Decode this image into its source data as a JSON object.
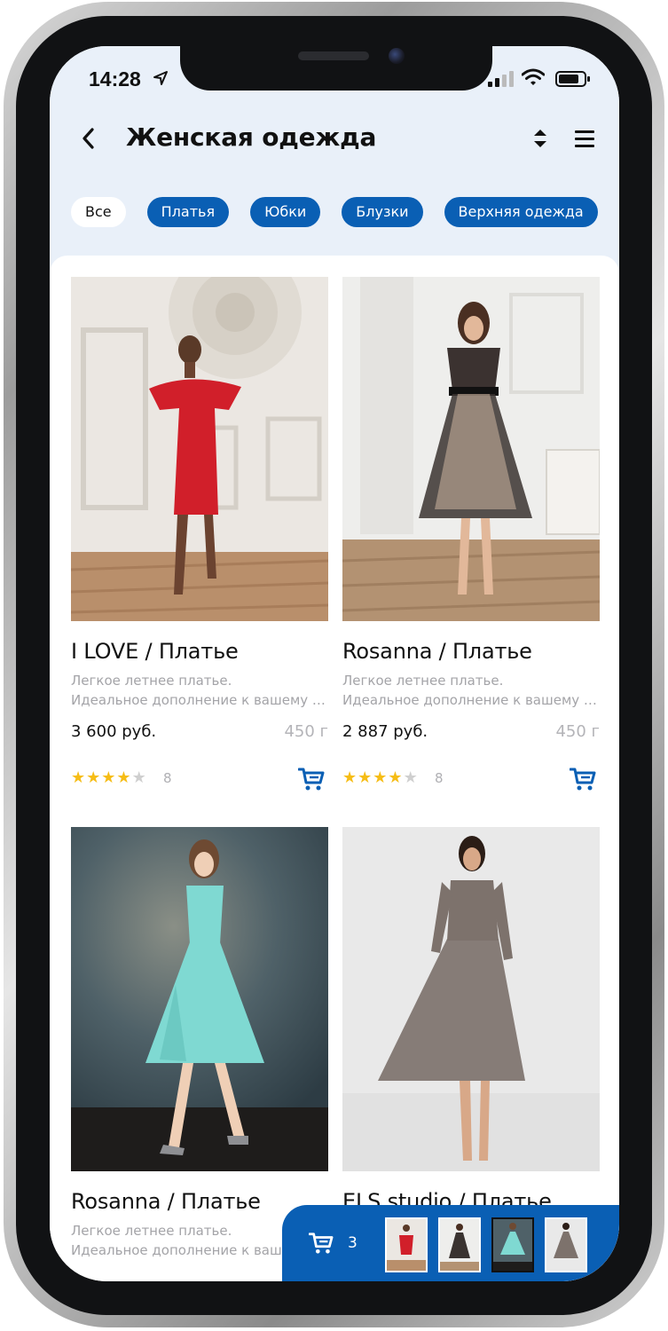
{
  "status_bar": {
    "time": "14:28"
  },
  "header": {
    "title": "Женская одежда",
    "back_icon": "chevron-left-icon",
    "sort_icon": "sort-icon",
    "menu_icon": "hamburger-menu-icon"
  },
  "categories": [
    {
      "label": "Все",
      "active": true
    },
    {
      "label": "Платья",
      "active": false
    },
    {
      "label": "Юбки",
      "active": false
    },
    {
      "label": "Блузки",
      "active": false
    },
    {
      "label": "Верхняя одежда",
      "active": false
    }
  ],
  "products": [
    {
      "name": "I LOVE / Платье",
      "desc_line1": "Легкое летнее платье.",
      "desc_line2": "Идеальное дополнение к вашему гардеробу",
      "price": "3 600 руб.",
      "weight": "450 г",
      "rating": 4,
      "rating_max": 5,
      "reviews": "8",
      "dress_color": "#d11f2a"
    },
    {
      "name": "Rosanna / Платье",
      "desc_line1": "Легкое летнее платье.",
      "desc_line2": "Идеальное дополнение к вашему гардеробу",
      "price": "2 887 руб.",
      "weight": "450 г",
      "rating": 4,
      "rating_max": 5,
      "reviews": "8",
      "dress_color": "#3a3330"
    },
    {
      "name": "Rosanna / Платье",
      "desc_line1": "Легкое летнее платье.",
      "desc_line2": "Идеальное дополнение к вашему гардеробу",
      "dress_color": "#7fd9d2"
    },
    {
      "name": "ELS studio / Платье",
      "dress_color": "#7d726c"
    }
  ],
  "cart": {
    "count": "3",
    "icon": "shopping-cart-icon"
  },
  "colors": {
    "accent": "#0a5fb4",
    "header_bg": "#e9f0f9",
    "star": "#f6bd16"
  }
}
